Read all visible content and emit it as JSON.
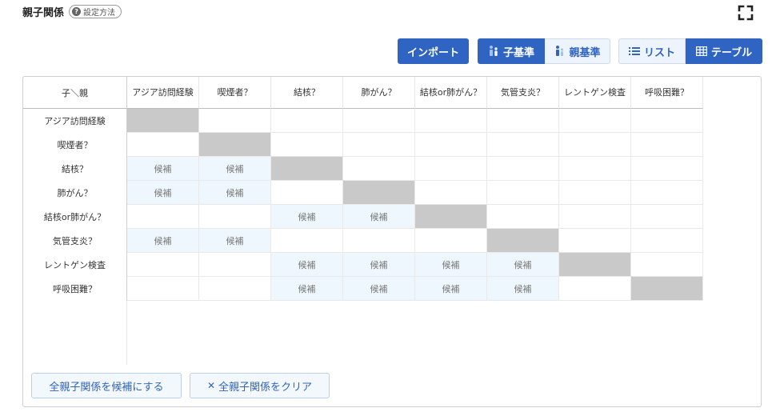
{
  "header": {
    "title": "親子関係",
    "help_label": "設定方法",
    "help_glyph": "?"
  },
  "toolbar": {
    "import_label": "インポート",
    "child_basis_label": "子基準",
    "parent_basis_label": "親基準",
    "list_label": "リスト",
    "table_label": "テーブル"
  },
  "table": {
    "corner_label": "子＼親",
    "columns": [
      "アジア訪問経験",
      "喫煙者？",
      "結核？",
      "肺がん？",
      "結核or肺がん？",
      "気管支炎？",
      "レントゲン検査",
      "呼吸困難？"
    ],
    "rows": [
      "アジア訪問経験",
      "喫煙者？",
      "結核？",
      "肺がん？",
      "結核or肺がん？",
      "気管支炎？",
      "レントゲン検査",
      "呼吸困難？"
    ],
    "candidate_label": "候補",
    "cells": [
      [
        "diag",
        "",
        "",
        "",
        "",
        "",
        "",
        ""
      ],
      [
        "",
        "diag",
        "",
        "",
        "",
        "",
        "",
        ""
      ],
      [
        "cand",
        "cand",
        "diag",
        "",
        "",
        "",
        "",
        ""
      ],
      [
        "cand",
        "cand",
        "",
        "diag",
        "",
        "",
        "",
        ""
      ],
      [
        "",
        "",
        "cand",
        "cand",
        "diag",
        "",
        "",
        ""
      ],
      [
        "cand",
        "cand",
        "",
        "",
        "",
        "diag",
        "",
        ""
      ],
      [
        "",
        "",
        "cand",
        "cand",
        "cand",
        "cand",
        "diag",
        ""
      ],
      [
        "",
        "",
        "cand",
        "cand",
        "cand",
        "cand",
        "",
        "diag"
      ]
    ]
  },
  "actions": {
    "set_all_candidates_label": "全親子関係を候補にする",
    "clear_all_label": "全親子関係をクリア",
    "clear_glyph": "✕"
  },
  "colors": {
    "primary": "#2f64c2",
    "candidate_bg": "#eef7fd",
    "diagonal_bg": "#c9c9c9"
  }
}
